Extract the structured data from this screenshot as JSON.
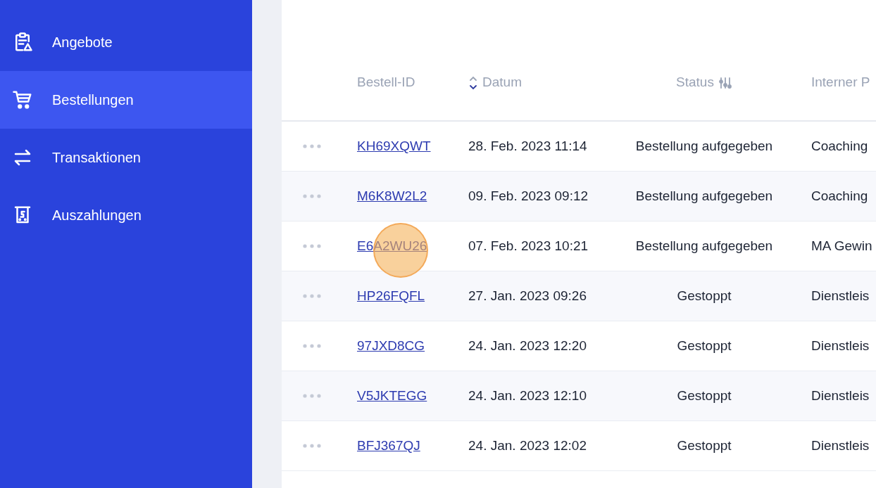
{
  "sidebar": {
    "items": [
      {
        "label": "Angebote",
        "kind": "clipboard",
        "selected": false
      },
      {
        "label": "Bestellungen",
        "kind": "cart",
        "selected": true
      },
      {
        "label": "Transaktionen",
        "kind": "arrows",
        "selected": false
      },
      {
        "label": "Auszahlungen",
        "kind": "payout",
        "selected": false
      }
    ]
  },
  "table": {
    "columns": [
      {
        "label": "Bestell-ID",
        "kind": "plain"
      },
      {
        "label": "Datum",
        "kind": "sort"
      },
      {
        "label": "Status",
        "kind": "filter"
      },
      {
        "label": "Interner P",
        "kind": "plain"
      }
    ],
    "rows": [
      {
        "id": "KH69XQWT",
        "date": "28. Feb. 2023 11:14",
        "status": "Bestellung aufgegeben",
        "internal": "Coaching",
        "clicked": false
      },
      {
        "id": "M6K8W2L2",
        "date": "09. Feb. 2023 09:12",
        "status": "Bestellung aufgegeben",
        "internal": "Coaching",
        "clicked": false
      },
      {
        "id": "E6A2WU26",
        "date": "07. Feb. 2023 10:21",
        "status": "Bestellung aufgegeben",
        "internal": "MA Gewin",
        "clicked": true
      },
      {
        "id": "HP26FQFL",
        "date": "27. Jan. 2023 09:26",
        "status": "Gestoppt",
        "internal": "Dienstleis",
        "clicked": false
      },
      {
        "id": "97JXD8CG",
        "date": "24. Jan. 2023 12:20",
        "status": "Gestoppt",
        "internal": "Dienstleis",
        "clicked": false
      },
      {
        "id": "V5JKTEGG",
        "date": "24. Jan. 2023 12:10",
        "status": "Gestoppt",
        "internal": "Dienstleis",
        "clicked": false
      },
      {
        "id": "BFJ367QJ",
        "date": "24. Jan. 2023 12:02",
        "status": "Gestoppt",
        "internal": "Dienstleis",
        "clicked": false
      }
    ]
  }
}
